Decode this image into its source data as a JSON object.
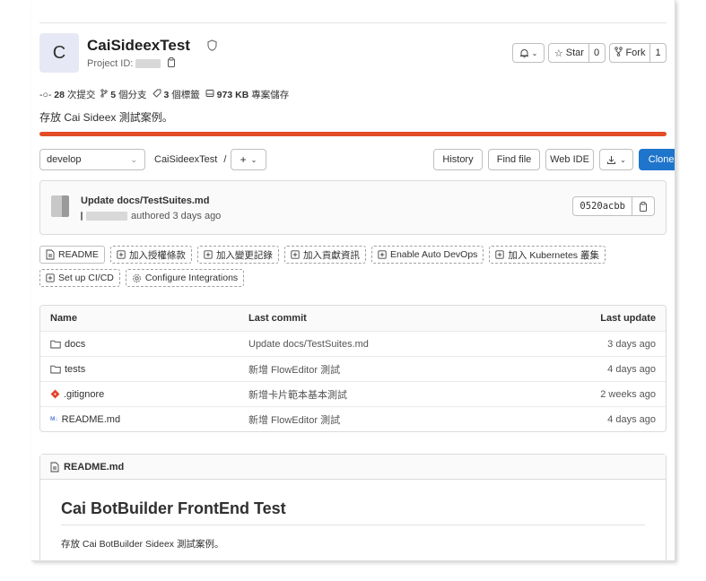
{
  "project": {
    "avatar_letter": "C",
    "name": "CaiSideexTest",
    "id_label": "Project ID:",
    "notify_icon": "bell-icon",
    "star_label": "Star",
    "star_count": "0",
    "fork_label": "Fork",
    "fork_count": "1"
  },
  "stats": {
    "commits_count": "28",
    "commits_label": "次提交",
    "branches_count": "5",
    "branches_label": "個分支",
    "tags_count": "3",
    "tags_label": "個標籤",
    "storage_size": "973 KB",
    "storage_label": "專案儲存"
  },
  "description": "存放 Cai Sideex 測試案例。",
  "colors": {
    "language_bar": "#e34c26",
    "primary": "#1f75cb"
  },
  "repo_nav": {
    "branch": "develop",
    "breadcrumb": "CaiSideexTest",
    "breadcrumb_sep": "/",
    "add_label": "+",
    "history": "History",
    "find_file": "Find file",
    "web_ide": "Web IDE",
    "clone": "Clone"
  },
  "last_commit": {
    "message": "Update docs/TestSuites.md",
    "meta": "authored 3 days ago",
    "sha": "0520acbb"
  },
  "shortcuts": [
    {
      "label": "README",
      "style": "solid",
      "icon": "file-icon"
    },
    {
      "label": "加入授權條款",
      "style": "dashed",
      "icon": "plus-square-icon"
    },
    {
      "label": "加入變更記錄",
      "style": "dashed",
      "icon": "plus-square-icon"
    },
    {
      "label": "加入貢獻資訊",
      "style": "dashed",
      "icon": "plus-square-icon"
    },
    {
      "label": "Enable Auto DevOps",
      "style": "dashed",
      "icon": "plus-square-icon"
    },
    {
      "label": "加入 Kubernetes 叢集",
      "style": "dashed",
      "icon": "plus-square-icon"
    },
    {
      "label": "Set up CI/CD",
      "style": "dashed",
      "icon": "plus-square-icon"
    },
    {
      "label": "Configure Integrations",
      "style": "dashed",
      "icon": "gear-icon"
    }
  ],
  "files": {
    "headers": {
      "name": "Name",
      "last_commit": "Last commit",
      "last_update": "Last update"
    },
    "rows": [
      {
        "name": "docs",
        "icon": "folder-icon",
        "commit": "Update docs/TestSuites.md",
        "updated": "3 days ago"
      },
      {
        "name": "tests",
        "icon": "folder-icon",
        "commit": "新增 FlowEditor 測試",
        "updated": "4 days ago"
      },
      {
        "name": ".gitignore",
        "icon": "git-icon",
        "commit": "新增卡片範本基本測試",
        "updated": "2 weeks ago"
      },
      {
        "name": "README.md",
        "icon": "markdown-icon",
        "commit": "新增 FlowEditor 測試",
        "updated": "4 days ago"
      }
    ]
  },
  "readme": {
    "filename": "README.md",
    "heading": "Cai BotBuilder FrontEnd Test",
    "text": "存放 Cai BotBuilder Sideex 測試案例。"
  }
}
